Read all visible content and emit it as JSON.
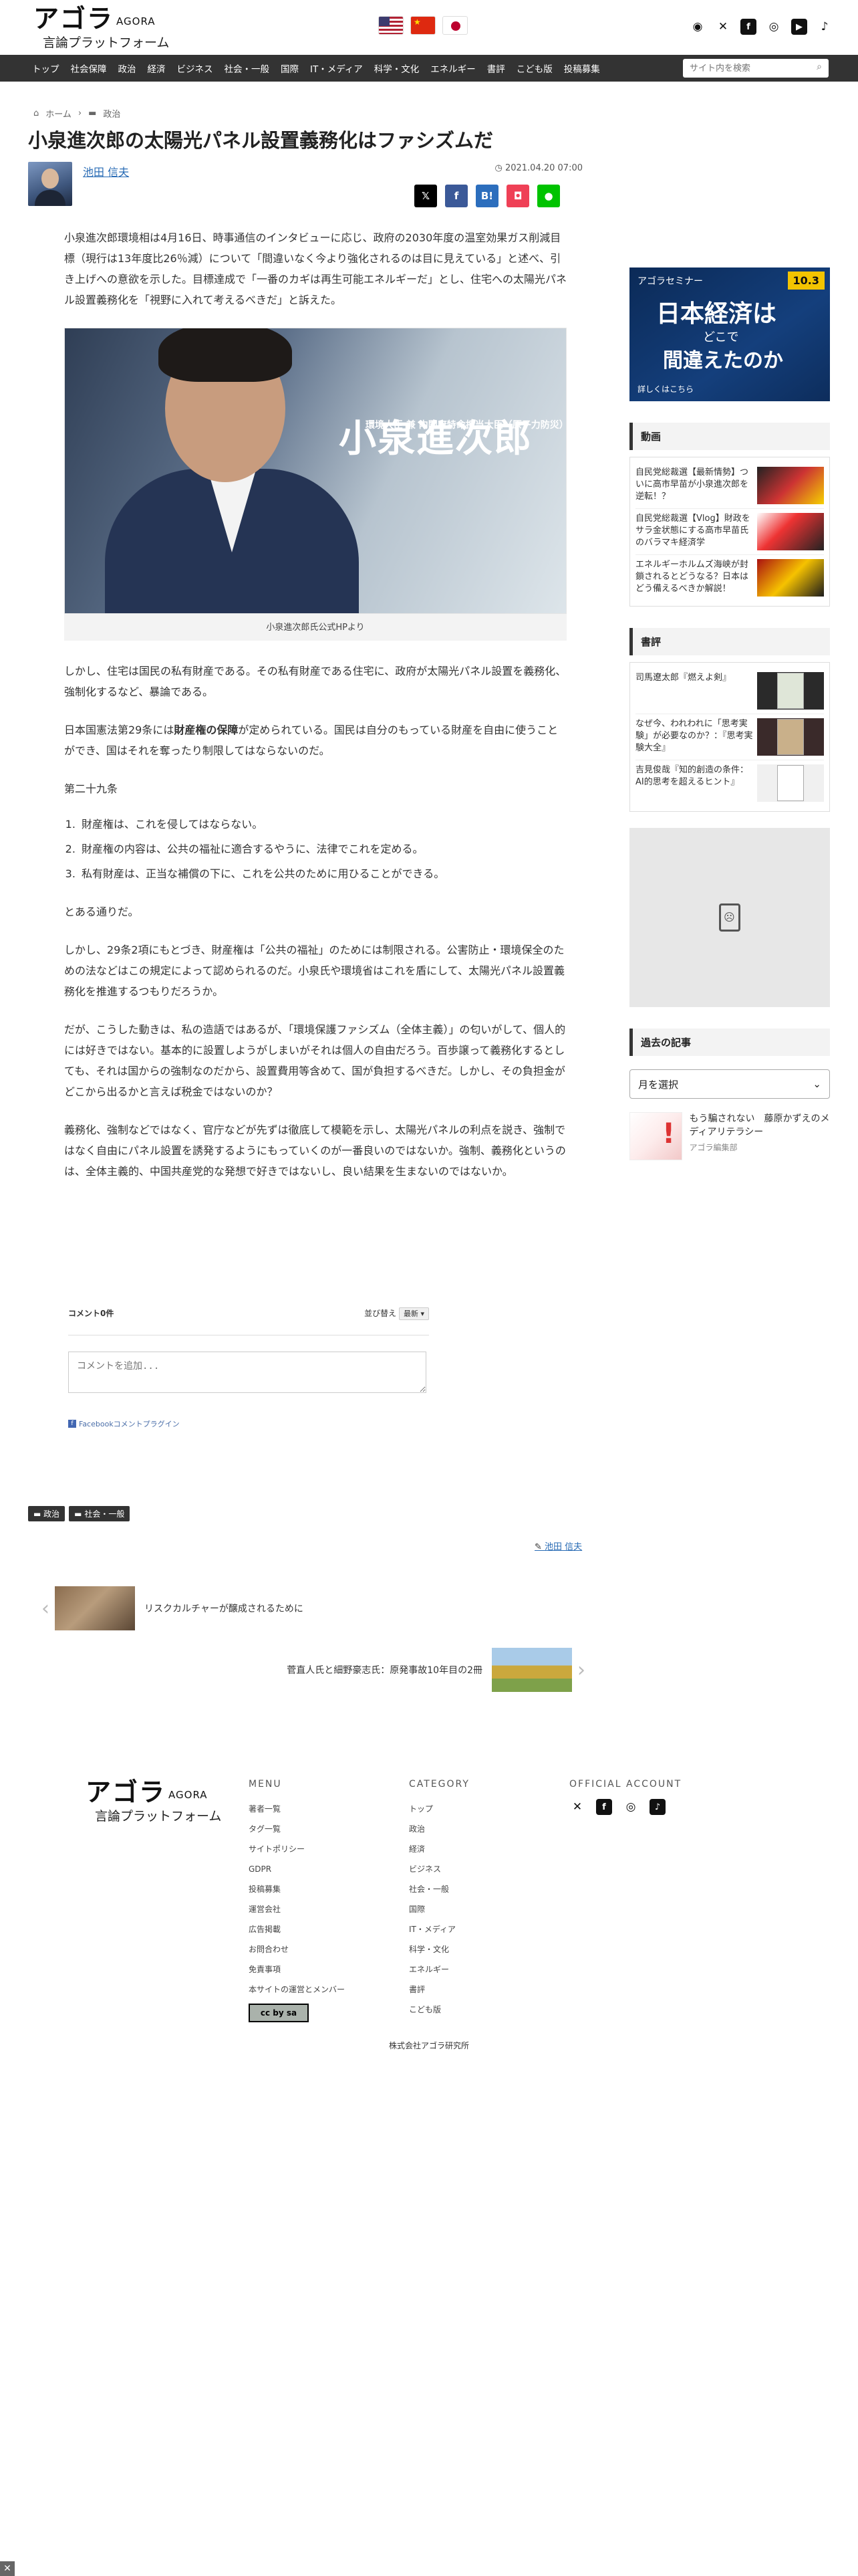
{
  "header": {
    "logo_main": "アゴラ",
    "logo_en": "AGORA",
    "logo_sub": "言論プラットフォーム",
    "flags": [
      "us-flag",
      "cn-flag",
      "jp-flag"
    ]
  },
  "nav": {
    "items": [
      "トップ",
      "社会保障",
      "政治",
      "経済",
      "ビジネス",
      "社会・一般",
      "国際",
      "IT・メディア",
      "科学・文化",
      "エネルギー",
      "書評",
      "こども版",
      "投稿募集"
    ],
    "search_placeholder": "サイト内を検索"
  },
  "breadcrumb": {
    "home": "ホーム",
    "category": "政治"
  },
  "article": {
    "title": "小泉進次郎の太陽光パネル設置義務化はファシズムだ",
    "author": "池田 信夫",
    "date": "2021.04.20 07:00",
    "p1": "小泉進次郎環境相は4月16日、時事通信のインタビューに応じ、政府の2030年度の温室効果ガス削減目標（現行は13年度比26％減）について「間違いなく今より強化されるのは目に見えている」と述べ、引き上げへの意欲を示した。目標達成で「一番のカギは再生可能エネルギーだ」とし、住宅への太陽光パネル設置義務化を「視野に入れて考えるべきだ」と訴えた。",
    "hero_small": "環境大臣 兼 内閣府特命担当大臣（原子力防災）",
    "hero_name": "小泉進次郎",
    "caption": "小泉進次郎氏公式HPより",
    "p2": "しかし、住宅は国民の私有財産である。その私有財産である住宅に、政府が太陽光パネル設置を義務化、強制化するなど、暴論である。",
    "p3a": "日本国憲法第29条には",
    "p3b": "財産権の保障",
    "p3c": "が定められている。国民は自分のもっている財産を自由に使うことができ、国はそれを奪ったり制限してはならないのだ。",
    "p4": "第二十九条",
    "law": [
      "財産権は、これを侵してはならない。",
      "財産権の内容は、公共の福祉に適合するやうに、法律でこれを定める。",
      "私有財産は、正当な補償の下に、これを公共のために用ひることができる。"
    ],
    "p5": "とある通りだ。",
    "p6": "しかし、29条2項にもとづき、財産権は「公共の福祉」のためには制限される。公害防止・環境保全のための法などはこの規定によって認められるのだ。小泉氏や環境省はこれを盾にして、太陽光パネル設置義務化を推進するつもりだろうか。",
    "p7": "だが、こうした動きは、私の造語ではあるが、「環境保護ファシズム（全体主義）」の匂いがして、個人的には好きではない。基本的に設置しようがしまいがそれは個人の自由だろう。百歩譲って義務化するとしても、それは国からの強制なのだから、設置費用等含めて、国が負担するべきだ。しかし、その負担金がどこから出るかと言えば税金ではないのか？",
    "p8": "義務化、強制などではなく、官庁などが先ずは徹底して模範を示し、太陽光パネルの利点を説き、強制ではなく自由にパネル設置を誘発するようにもっていくのが一番良いのではないか。強制、義務化というのは、全体主義的、中国共産党的な発想で好きではないし、良い結果を生まないのではないか。"
  },
  "comments": {
    "count_label": "コメント0件",
    "sort_label": "並び替え",
    "sort_value": "最新",
    "placeholder": "コメントを追加...",
    "plugin": "Facebookコメントプラグイン"
  },
  "tags": [
    "政治",
    "社会・一般"
  ],
  "byline": "池田 信夫",
  "pager": {
    "prev": "リスクカルチャーが醸成されるために",
    "next": "菅直人氏と細野豪志氏：原発事故10年目の2冊"
  },
  "sidebar": {
    "seminar": {
      "label": "アゴラセミナー",
      "date": "10.3",
      "title1": "日本経済は",
      "title2": "どこで",
      "title3": "間違えたのか",
      "more": "詳しくはこちら"
    },
    "video_head": "動画",
    "videos": [
      "自民党総裁選【最新情勢】ついに高市早苗が小泉進次郎を逆転！？",
      "自民党総裁選【Vlog】財政をサラ金状態にする高市早苗氏のバラマキ経済学",
      "エネルギーホルムズ海峡が封鎖されるとどうなる？日本はどう備えるべきか解説！"
    ],
    "book_head": "書評",
    "books": [
      "司馬遼太郎『燃えよ剣』",
      "なぜ今、われわれに「思考実験」が必要なのか？：『思考実験大全』",
      "吉見俊哉『知的創造の条件：AI的思考を超えるヒント』"
    ],
    "past_head": "過去の記事",
    "month_select": "月を選択",
    "past_title": "もう騙されない　藤原かずえのメディアリテラシー",
    "past_meta": "アゴラ編集部"
  },
  "footer": {
    "menu_head": "MENU",
    "menu": [
      "著者一覧",
      "タグ一覧",
      "サイトポリシー",
      "GDPR",
      "投稿募集",
      "運営会社",
      "広告掲載",
      "お問合わせ",
      "免責事項",
      "本サイトの運営とメンバー"
    ],
    "cat_head": "CATEGORY",
    "categories": [
      "トップ",
      "政治",
      "経済",
      "ビジネス",
      "社会・一般",
      "国際",
      "IT・メディア",
      "科学・文化",
      "エネルギー",
      "書評",
      "こども版"
    ],
    "official_head": "OFFICIAL ACCOUNT",
    "company": "株式会社アゴラ研究所",
    "cc": "cc by sa"
  },
  "colors": {
    "nav_bg": "#333333",
    "link": "#2a6cb5",
    "twitter": "#000000",
    "facebook": "#3b5998",
    "hatena": "#2c6ebd",
    "pocket": "#ef4056",
    "line": "#00c300"
  }
}
